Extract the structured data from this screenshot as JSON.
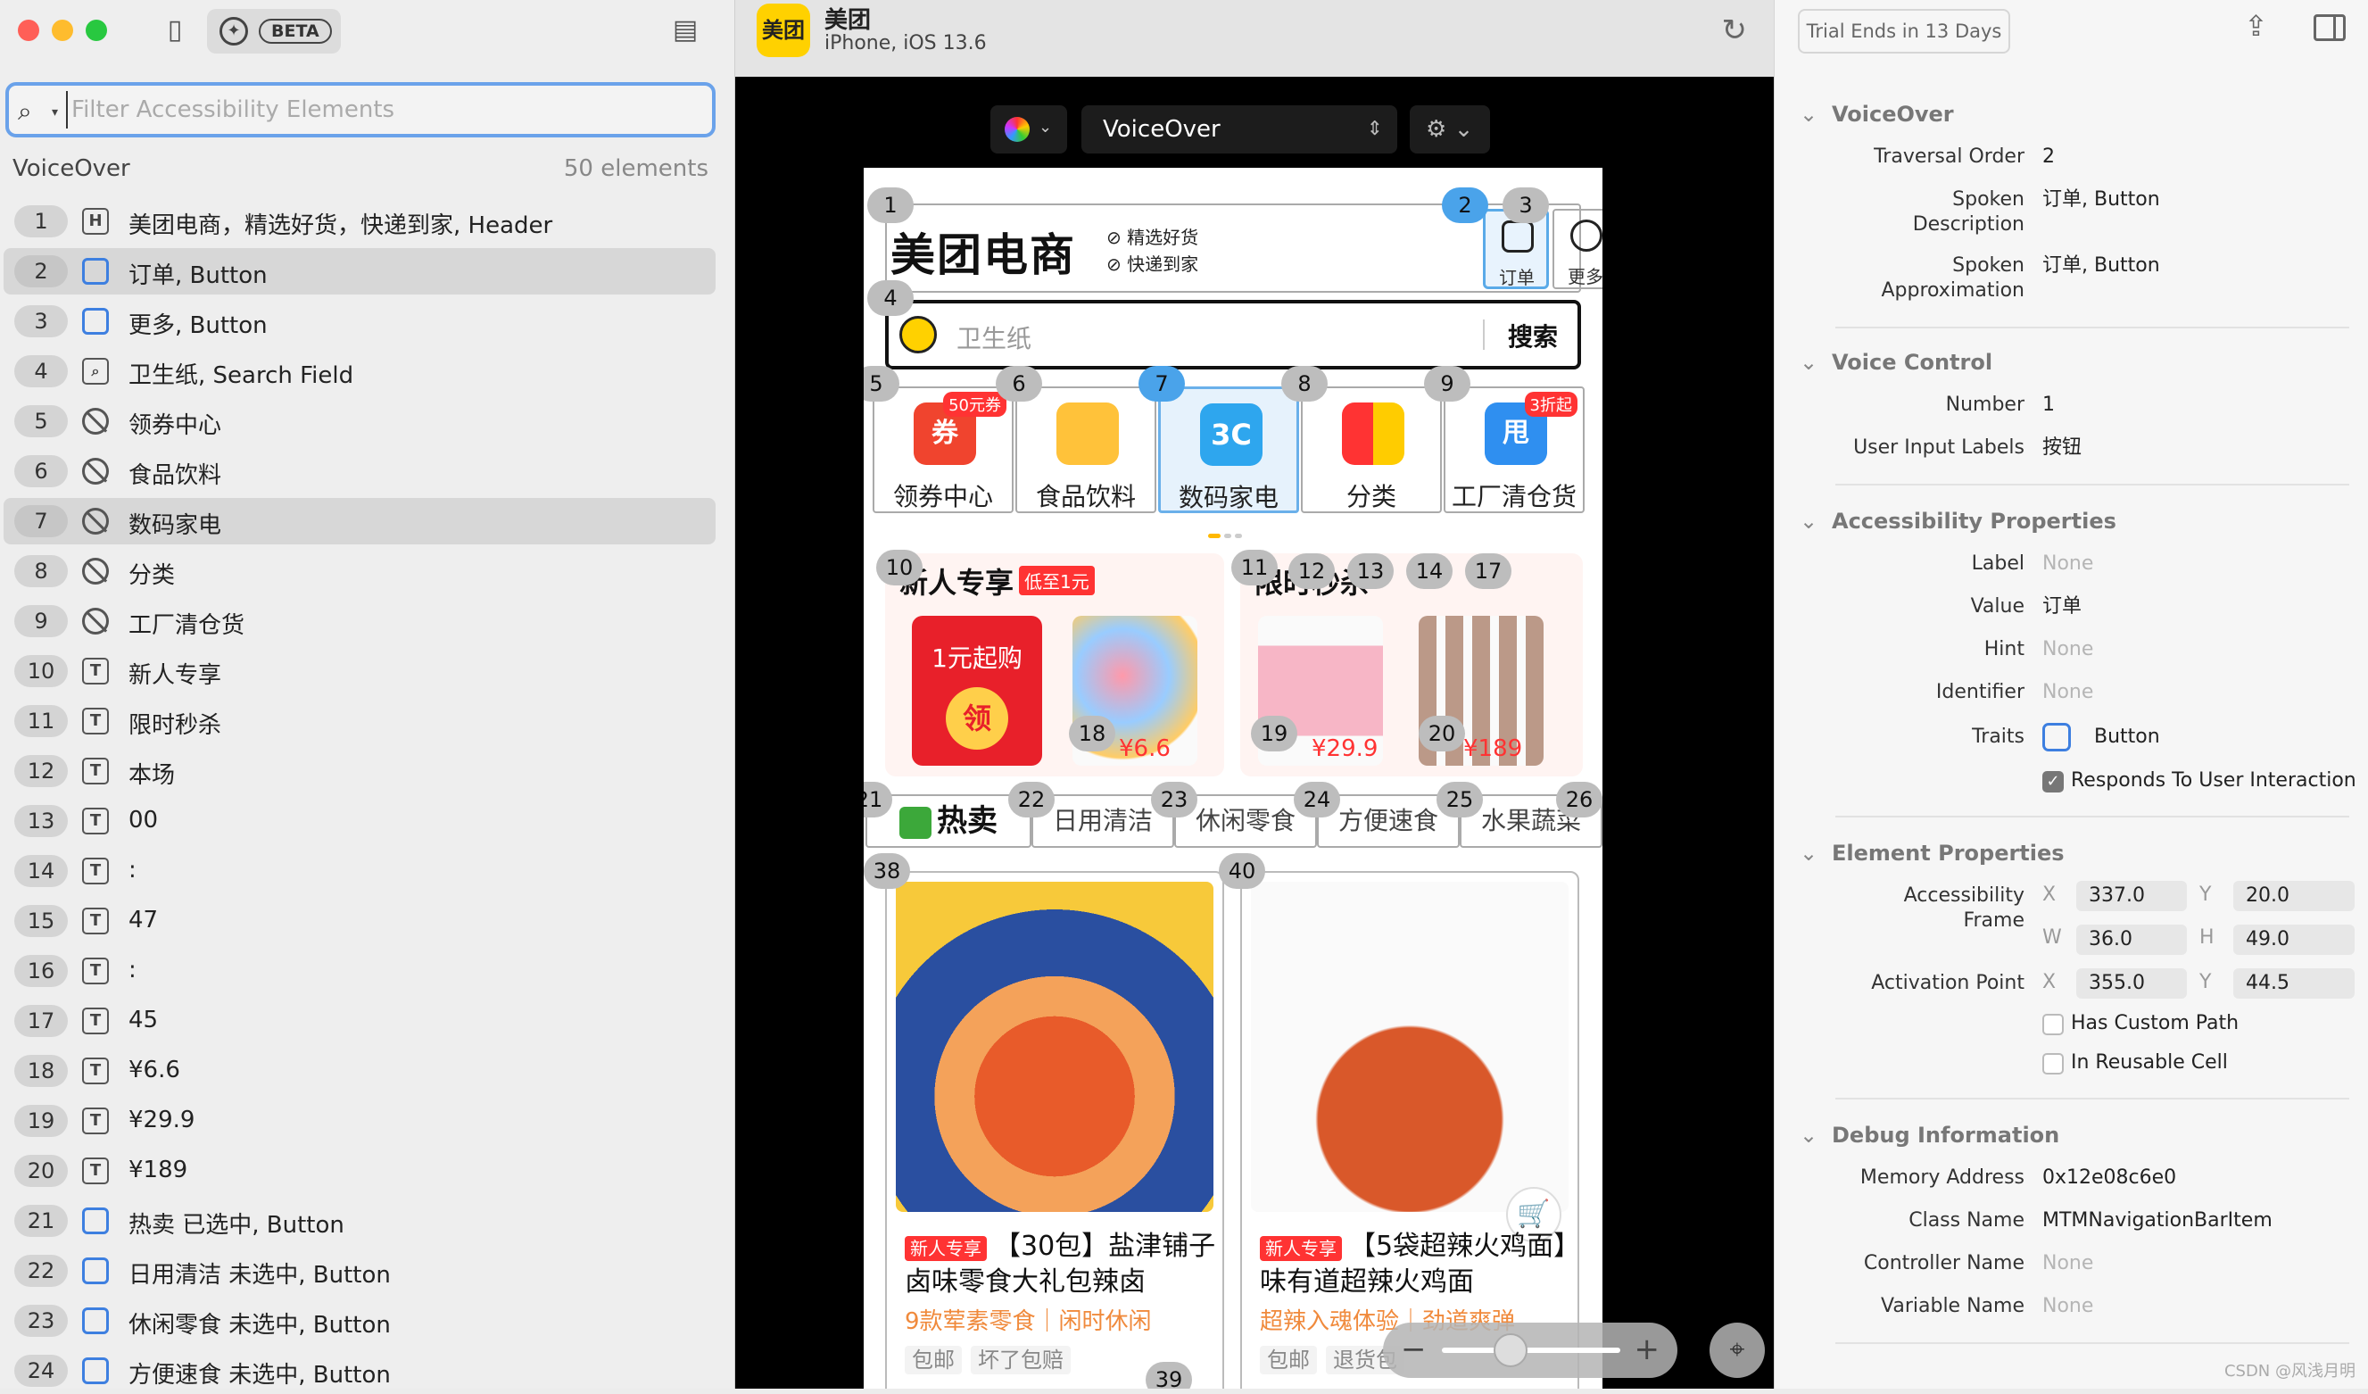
{
  "left": {
    "beta_label": "BETA",
    "search_placeholder": "Filter Accessibility Elements",
    "section_title": "VoiceOver",
    "section_count": "50 elements",
    "elements": [
      {
        "n": "1",
        "type": "H",
        "label": "美团电商，精选好货，快递到家, Header"
      },
      {
        "n": "2",
        "type": "btn",
        "label": "订单, Button",
        "selected": true
      },
      {
        "n": "3",
        "type": "btn",
        "label": "更多, Button"
      },
      {
        "n": "4",
        "type": "sf",
        "label": "卫生纸, Search Field"
      },
      {
        "n": "5",
        "type": "img",
        "label": "领券中心"
      },
      {
        "n": "6",
        "type": "img",
        "label": "食品饮料"
      },
      {
        "n": "7",
        "type": "img",
        "label": "数码家电",
        "selected": true
      },
      {
        "n": "8",
        "type": "img",
        "label": "分类"
      },
      {
        "n": "9",
        "type": "img",
        "label": "工厂清仓货"
      },
      {
        "n": "10",
        "type": "T",
        "label": "新人专享"
      },
      {
        "n": "11",
        "type": "T",
        "label": "限时秒杀"
      },
      {
        "n": "12",
        "type": "T",
        "label": "本场"
      },
      {
        "n": "13",
        "type": "T",
        "label": "00"
      },
      {
        "n": "14",
        "type": "T",
        "label": ":"
      },
      {
        "n": "15",
        "type": "T",
        "label": "47"
      },
      {
        "n": "16",
        "type": "T",
        "label": ":"
      },
      {
        "n": "17",
        "type": "T",
        "label": "45"
      },
      {
        "n": "18",
        "type": "T",
        "label": "¥6.6"
      },
      {
        "n": "19",
        "type": "T",
        "label": "¥29.9"
      },
      {
        "n": "20",
        "type": "T",
        "label": "¥189"
      },
      {
        "n": "21",
        "type": "btn",
        "label": "热卖 已选中, Button"
      },
      {
        "n": "22",
        "type": "btn",
        "label": "日用清洁 未选中, Button"
      },
      {
        "n": "23",
        "type": "btn",
        "label": "休闲零食 未选中, Button"
      },
      {
        "n": "24",
        "type": "btn",
        "label": "方便速食 未选中, Button"
      }
    ]
  },
  "center": {
    "app_icon_text": "美团",
    "app_name": "美团",
    "device": "iPhone, iOS 13.6",
    "vo_mode": "VoiceOver",
    "phone": {
      "brand": "美团电商",
      "tag1": "⊘ 精选好货",
      "tag2": "⊘ 快递到家",
      "order_label": "订单",
      "more_label": "更多",
      "search_placeholder": "卫生纸",
      "search_button": "搜索",
      "categories": [
        {
          "label": "领券中心",
          "badge": "50元券",
          "icon_text": "券"
        },
        {
          "label": "食品饮料",
          "badge": "",
          "icon_text": ""
        },
        {
          "label": "数码家电",
          "badge": "",
          "icon_text": "3C"
        },
        {
          "label": "分类",
          "badge": "",
          "icon_text": ""
        },
        {
          "label": "工厂清仓货",
          "badge": "3折起",
          "icon_text": "甩"
        }
      ],
      "promo_new_title": "新人专享",
      "promo_new_tag": "低至1元",
      "promo_new_env": "1元起购",
      "promo_new_coin": "领",
      "promo_flash_title": "限时秒杀",
      "price_1": "¥6.6",
      "price_2": "¥29.9",
      "price_3": "¥189",
      "tabs": [
        "热卖",
        "日用清洁",
        "休闲零食",
        "方便速食",
        "水果蔬菜"
      ],
      "card1": {
        "new_tag": "新人专享",
        "title": "【30包】盐津铺子卤味零食大礼包辣卤",
        "sub": "9款荤素零食｜闲时休闲",
        "chips": [
          "包邮",
          "坏了包赔"
        ]
      },
      "card2": {
        "new_tag": "新人专享",
        "title": "【5袋超辣火鸡面】味有道超辣火鸡面",
        "sub": "超辣入魂体验｜劲道爽弹",
        "chips": [
          "包邮",
          "退货包"
        ]
      }
    }
  },
  "right": {
    "trial": "Trial Ends in 13 Days",
    "voiceover": {
      "title": "VoiceOver",
      "traversal_order_k": "Traversal Order",
      "traversal_order_v": "2",
      "spoken_desc_k1": "Spoken",
      "spoken_desc_k2": "Description",
      "spoken_desc_v": "订单, Button",
      "spoken_approx_k1": "Spoken",
      "spoken_approx_k2": "Approximation",
      "spoken_approx_v": "订单, Button"
    },
    "voice_control": {
      "title": "Voice Control",
      "number_k": "Number",
      "number_v": "1",
      "labels_k": "User Input Labels",
      "labels_v": "按钮"
    },
    "a11y": {
      "title": "Accessibility Properties",
      "label_k": "Label",
      "label_v": "None",
      "value_k": "Value",
      "value_v": "订单",
      "hint_k": "Hint",
      "hint_v": "None",
      "identifier_k": "Identifier",
      "identifier_v": "None",
      "traits_k": "Traits",
      "traits_v": "Button",
      "responds": "Responds To User Interaction"
    },
    "element": {
      "title": "Element Properties",
      "frame_k1": "Accessibility",
      "frame_k2": "Frame",
      "fx": "337.0",
      "fy": "20.0",
      "fw": "36.0",
      "fh": "49.0",
      "act_k": "Activation Point",
      "ax": "355.0",
      "ay": "44.5",
      "custom_path": "Has Custom Path",
      "reusable": "In Reusable Cell"
    },
    "debug": {
      "title": "Debug Information",
      "mem_k": "Memory Address",
      "mem_v": "0x12e08c6e0",
      "class_k": "Class Name",
      "class_v": "MTMNavigationBarItem",
      "ctrl_k": "Controller Name",
      "ctrl_v": "None",
      "var_k": "Variable Name",
      "var_v": "None"
    },
    "watermark": "CSDN @风浅月明"
  }
}
